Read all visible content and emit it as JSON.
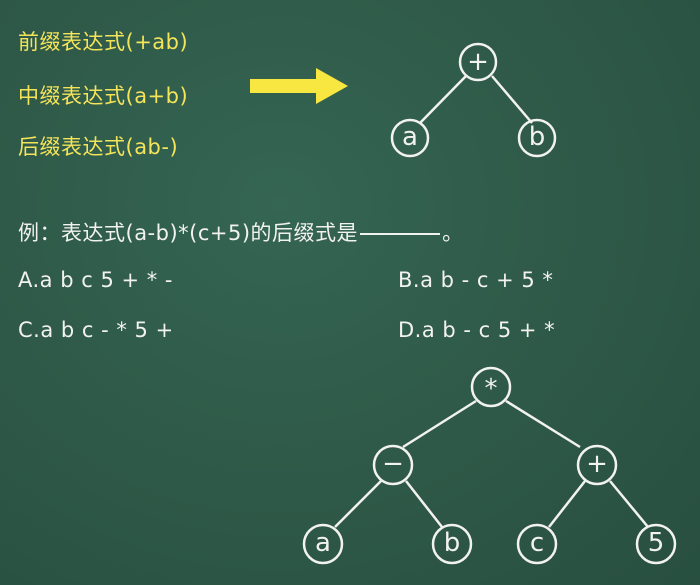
{
  "notations": {
    "prefix": "前缀表达式(+ab)",
    "infix": "中缀表达式(a+b)",
    "postfix": "后缀表达式(ab-)"
  },
  "arrow_color": "#f7e740",
  "tree1": {
    "root": "+",
    "left": "a",
    "right": "b"
  },
  "question": {
    "text_before": "例：表达式(a-b)*(c+5)的后缀式是",
    "text_after": "。"
  },
  "options": {
    "A": "A.a b c 5 + * -",
    "B": "B.a b - c + 5 *",
    "C": "C.a b c - * 5 +",
    "D": "D.a b - c 5 + *"
  },
  "tree2": {
    "root": "*",
    "left": "−",
    "right": "+",
    "left_left": "a",
    "left_right": "b",
    "right_left": "c",
    "right_right": "5"
  },
  "colors": {
    "board": "#2e5847",
    "yellow_text": "#f4e45a",
    "white_text": "#f2f2ee"
  }
}
